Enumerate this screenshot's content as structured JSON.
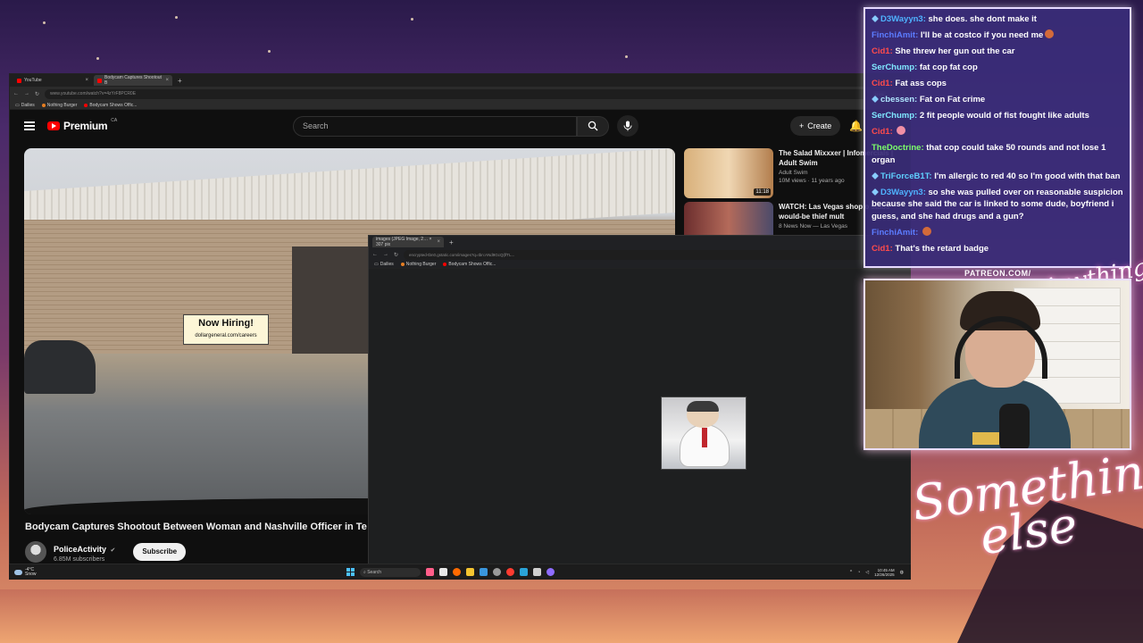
{
  "main_browser": {
    "tabs": [
      {
        "label": "YouTube",
        "active": false
      },
      {
        "label": "Bodycam Captures Shootout B",
        "active": true
      }
    ],
    "url": "www.youtube.com/watch?v=4zYrF8PCR0E",
    "zoom": "110%",
    "bookmarks": [
      "Dailies",
      "Nothing Burger",
      "Bodycam Shows Offic..."
    ]
  },
  "youtube": {
    "logo_text": "Premium",
    "logo_sup": "CA",
    "search_placeholder": "Search",
    "create_label": "Create",
    "video": {
      "title": "Bodycam Captures Shootout Between Woman and Nashville Officer in Te",
      "sign_title": "Now Hiring!",
      "sign_sub": "dollargeneral.com/careers",
      "channel": "PoliceActivity",
      "subscribers": "6.85M subscribers",
      "subscribe_label": "Subscribe"
    },
    "recommendations": [
      {
        "title": "The Salad Mixxxer | Infomercials | Adult Swim",
        "channel": "Adult Swim",
        "meta": "10M views · 11 years ago",
        "duration": "11:18",
        "thumb_color": "#c8a36a"
      },
      {
        "title": "WATCH: Las Vegas shop o stabs would-be thief mult",
        "channel": "8 News Now — Las Vegas",
        "meta": "",
        "duration": "",
        "thumb_color": "#7a3a3a"
      }
    ]
  },
  "popup_browser": {
    "tab_label": "images (JPEG Image, 2… × 307 pix",
    "url": "encrypted-tbn0.gstatic.com/images?q=tbn:ANd9GcQ(lfTL...",
    "bookmarks": [
      "Dailies",
      "Nothing Burger",
      "Bodycam Shows Offic..."
    ]
  },
  "taskbar": {
    "weather_temp": "-4°C",
    "weather_desc": "Snow",
    "search_label": "Search",
    "time": "10:45 AM",
    "date": "12/26/2025",
    "app_colors": [
      "#ff5e8a",
      "#e8e8e8",
      "#ff6a00",
      "#f4c430",
      "#3a96dd",
      "#9a9a9a",
      "#ff3b30",
      "#2aa3d8",
      "#cfcfcf",
      "#8e6cff"
    ]
  },
  "chat": [
    {
      "user": "D3Wayyn3",
      "color": "#4fb3ff",
      "badge": "sword",
      "text": "she does. she dont make it"
    },
    {
      "user": "FinchiAmit",
      "color": "#5c7cff",
      "badge": "",
      "text": "I'll be at costco if you need me",
      "emote": "#d36a3a"
    },
    {
      "user": "Cid1",
      "color": "#ff4b4b",
      "badge": "",
      "text": "She threw her gun out the car"
    },
    {
      "user": "SerChump",
      "color": "#7fe7ff",
      "badge": "",
      "text": "fat cop fat cop"
    },
    {
      "user": "Cid1",
      "color": "#ff4b4b",
      "badge": "",
      "text": "Fat ass cops"
    },
    {
      "user": "cbessen",
      "color": "#b0e7ff",
      "badge": "sword",
      "text": "Fat on Fat crime"
    },
    {
      "user": "SerChump",
      "color": "#7fe7ff",
      "badge": "",
      "text": "2 fit people would of fist fought like adults"
    },
    {
      "user": "Cid1",
      "color": "#ff4b4b",
      "badge": "",
      "text": "",
      "emote": "#f08fa5"
    },
    {
      "user": "TheDoctrine",
      "color": "#7cff6a",
      "badge": "",
      "text": "that cop could take 50 rounds and not lose 1 organ"
    },
    {
      "user": "TriForceB1T",
      "color": "#5fd0ff",
      "badge": "sword",
      "text": "I'm allergic to red 40 so I'm good with that ban"
    },
    {
      "user": "D3Wayyn3",
      "color": "#4fb3ff",
      "badge": "sword",
      "text": "so she was pulled over on reasonable suspicion because she said the car is linked to some dude, boyfriend i guess, and she had drugs and a gun?"
    },
    {
      "user": "FinchiAmit",
      "color": "#5c7cff",
      "badge": "",
      "text": "",
      "emote": "#d36a3a"
    },
    {
      "user": "Cid1",
      "color": "#ff4b4b",
      "badge": "",
      "text": "That's the retard badge"
    }
  ],
  "overlay": {
    "patreon_label": "PATREON.COM/",
    "signature_small": "Anything else",
    "signature_line1": "Something",
    "signature_line2": "else"
  }
}
